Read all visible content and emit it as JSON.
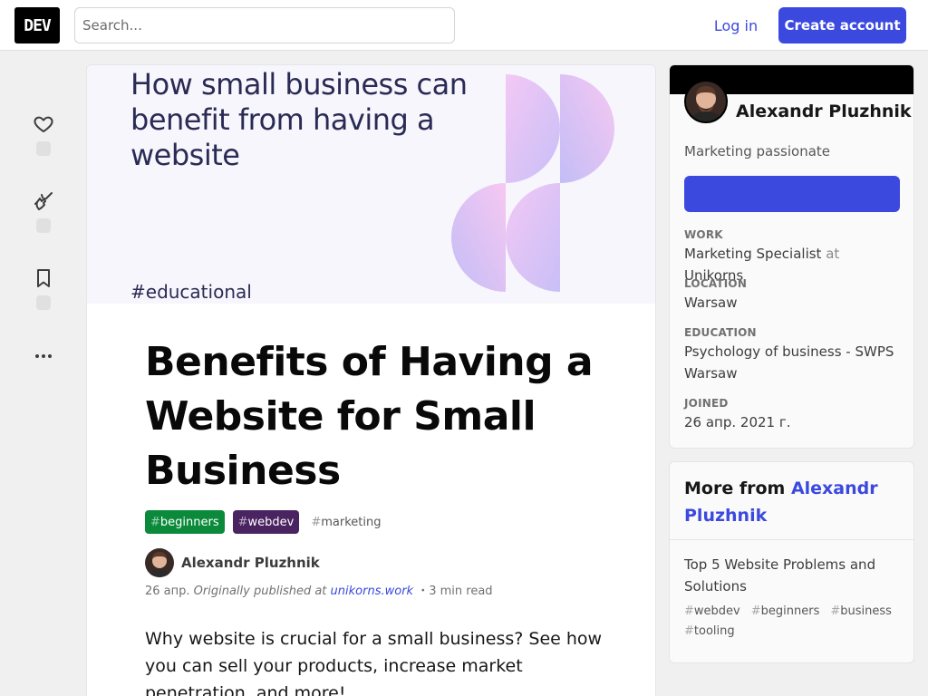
{
  "header": {
    "logo": "DEV",
    "search_placeholder": "Search...",
    "login": "Log in",
    "create_account": "Create account"
  },
  "accent": "#3b49df",
  "cover": {
    "title": "How small business can benefit from having a website",
    "tag": "#educational"
  },
  "article": {
    "title": "Benefits of Having a Website for Small Business",
    "tags": [
      {
        "hash": "#",
        "name": "beginners",
        "color": "#0a8a3a"
      },
      {
        "hash": "#",
        "name": "webdev",
        "color": "#4a2361"
      },
      {
        "hash": "#",
        "name": "marketing"
      }
    ],
    "author": "Alexandr Pluzhnik",
    "date": "26 апр.",
    "originally": "Originally published at",
    "origin_link": "unikorns.work",
    "read_time": "・3 min read",
    "intro": "Why website is crucial for a small business? See how you can sell your products, increase market penetration, and more!"
  },
  "profile": {
    "name": "Alexandr Pluzhnik",
    "bio": "Marketing passionate",
    "work_label": "WORK",
    "work_role": "Marketing Specialist",
    "work_at": "at",
    "work_company": "Unikorns",
    "location_label": "LOCATION",
    "location": "Warsaw",
    "education_label": "EDUCATION",
    "education": "Psychology of business - SWPS Warsaw",
    "joined_label": "JOINED",
    "joined": "26 апр. 2021 г."
  },
  "more_from": {
    "prefix": "More from",
    "author": "Alexandr Pluzhnik",
    "post_title": "Top 5 Website Problems and Solutions",
    "post_tags": [
      "webdev",
      "beginners",
      "business",
      "tooling"
    ],
    "hash": "#"
  }
}
